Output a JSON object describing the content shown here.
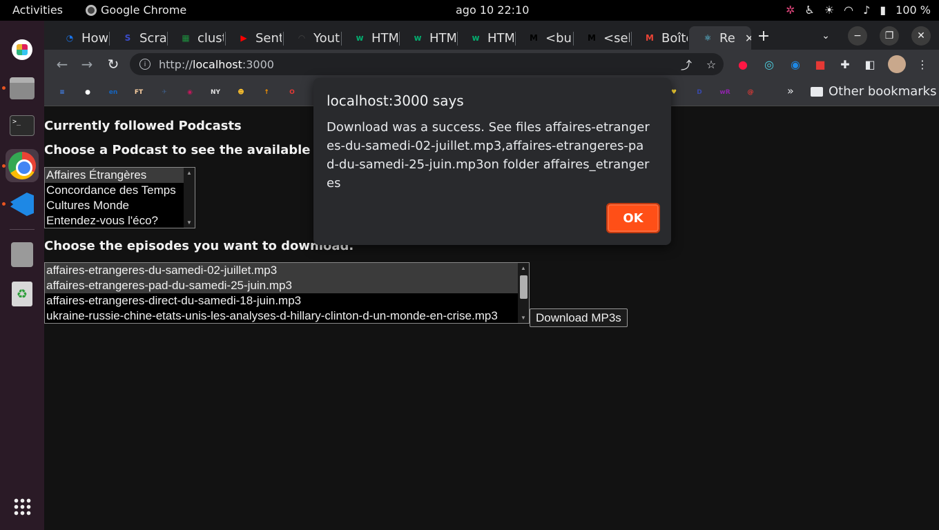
{
  "topbar": {
    "activities": "Activities",
    "app_name": "Google Chrome",
    "clock": "ago 10  22:10",
    "battery": "100 %"
  },
  "tabs": [
    {
      "label": "How",
      "fav_color": "#1a73e8",
      "fav_glyph": "◔"
    },
    {
      "label": "Scra",
      "fav_color": "#3b4cca",
      "fav_glyph": "S"
    },
    {
      "label": "clust",
      "fav_color": "#1e8e3e",
      "fav_glyph": "▦"
    },
    {
      "label": "Sent",
      "fav_color": "#ff0000",
      "fav_glyph": "▶"
    },
    {
      "label": "Yout",
      "fav_color": "#444444",
      "fav_glyph": "◠"
    },
    {
      "label": "HTM",
      "fav_color": "#04aa6d",
      "fav_glyph": "w"
    },
    {
      "label": "HTM",
      "fav_color": "#04aa6d",
      "fav_glyph": "w"
    },
    {
      "label": "HTM",
      "fav_color": "#04aa6d",
      "fav_glyph": "w"
    },
    {
      "label": "<but",
      "fav_color": "#000000",
      "fav_glyph": "M"
    },
    {
      "label": "<sele",
      "fav_color": "#000000",
      "fav_glyph": "M"
    },
    {
      "label": "Boîte",
      "fav_color": "#ea4335",
      "fav_glyph": "M"
    },
    {
      "label": "Re",
      "fav_color": "#61dafb",
      "fav_glyph": "⚛"
    }
  ],
  "toolbar": {
    "url_scheme": "http://",
    "url_host": "localhost",
    "url_port": ":3000"
  },
  "bookmarks": {
    "items": [
      {
        "glyph": "≡",
        "color": "#4285f4"
      },
      {
        "glyph": "●",
        "color": "#ffffff"
      },
      {
        "glyph": "en",
        "color": "#1565c0"
      },
      {
        "glyph": "FT",
        "color": "#fcd0a1"
      },
      {
        "glyph": "✈",
        "color": "#3d5a80"
      },
      {
        "glyph": "◉",
        "color": "#c2185b"
      },
      {
        "glyph": "NY",
        "color": "#e0e0e0"
      },
      {
        "glyph": "☻",
        "color": "#fbc02d"
      },
      {
        "glyph": "↑",
        "color": "#ff9800"
      },
      {
        "glyph": "O",
        "color": "#e53935"
      }
    ],
    "right_items": [
      {
        "glyph": "♥",
        "color": "#fdd835"
      },
      {
        "glyph": "D",
        "color": "#3949ab"
      },
      {
        "glyph": "wR",
        "color": "#8e24aa"
      },
      {
        "glyph": "@",
        "color": "#e53935"
      }
    ],
    "chevron": "»",
    "other": "Other bookmarks"
  },
  "page": {
    "heading_followed": "Currently followed Podcasts",
    "heading_choose": "Choose a Podcast to see the available episodes",
    "podcasts": [
      "Affaires Étrangères",
      "Concordance des Temps",
      "Cultures Monde",
      "Entendez-vous l'éco?"
    ],
    "heading_episodes": "Choose the episodes you want to download.",
    "episodes": [
      "affaires-etrangeres-du-samedi-02-juillet.mp3",
      "affaires-etrangeres-pad-du-samedi-25-juin.mp3",
      "affaires-etrangeres-direct-du-samedi-18-juin.mp3",
      "ukraine-russie-chine-etats-unis-les-analyses-d-hillary-clinton-d-un-monde-en-crise.mp3"
    ],
    "download_label": "Download MP3s"
  },
  "dialog": {
    "title": "localhost:3000 says",
    "message": "Download was a success. See files affaires-etrangeres-du-samedi-02-juillet.mp3,affaires-etrangeres-pad-du-samedi-25-juin.mp3on folder affaires_etrangeres",
    "ok_label": "OK"
  }
}
